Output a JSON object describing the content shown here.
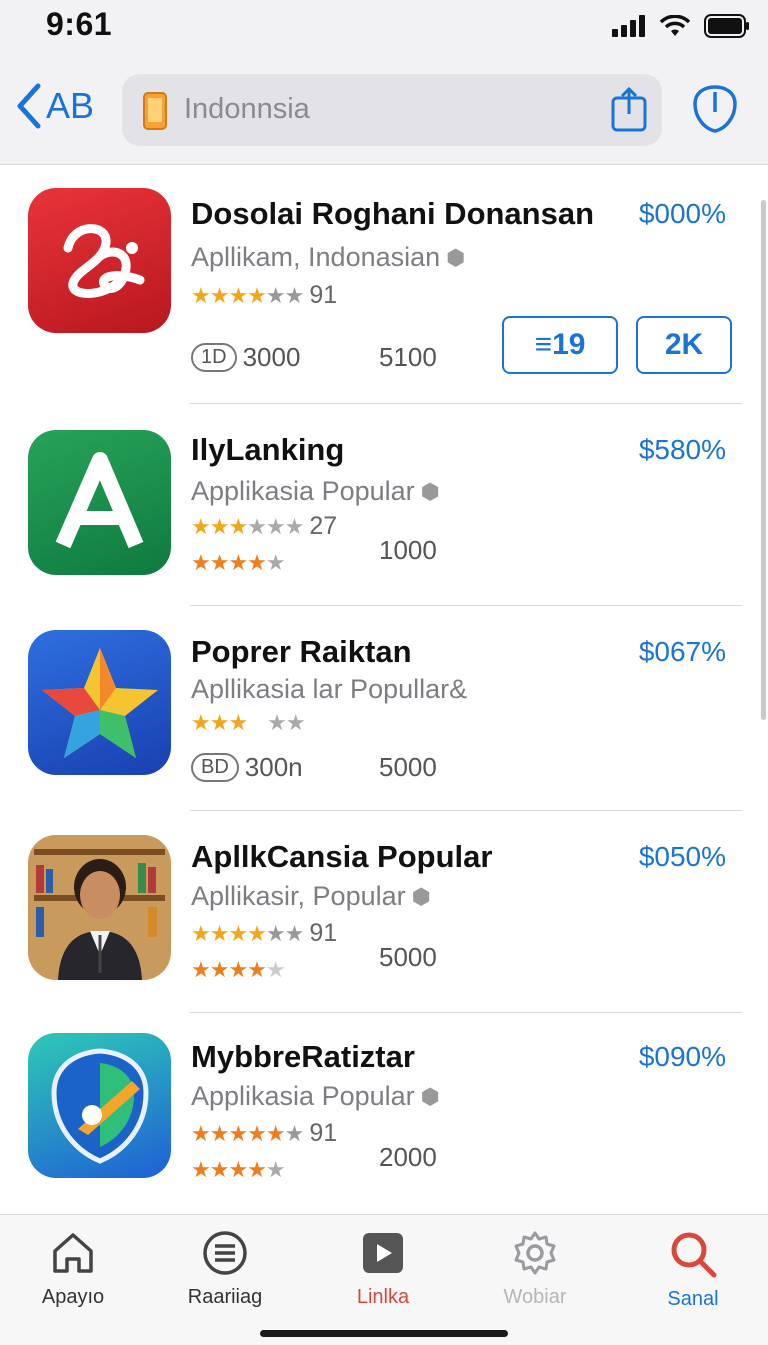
{
  "status_bar": {
    "time": "9:61"
  },
  "nav": {
    "back_label": "AB",
    "search_value": "Indonnsia"
  },
  "apps": [
    {
      "name": "Dosolai Roghani Donansan",
      "subtitle": "Apllikam, Indonasian",
      "price": "$000%",
      "rating_stars": 4,
      "rating_count": "91",
      "badge": "1D",
      "meta_1": "3000",
      "meta_2": "5100",
      "buttons": [
        "≡19",
        "2K"
      ],
      "icon": "script-logo-icon"
    },
    {
      "name": "IlyLanking",
      "subtitle": "Applikasia Popular",
      "price": "$580%",
      "rating_stars": 3,
      "rating_count": "27",
      "rating2_stars": 4,
      "meta_2": "1000",
      "icon": "letter-a-icon"
    },
    {
      "name": "Poprer Raiktan",
      "subtitle": "Apllikasia lar Popullar&",
      "price": "$067%",
      "rating_stars": 3,
      "badge": "BD",
      "meta_1": "300n",
      "meta_2": "5000",
      "icon": "star-icon"
    },
    {
      "name": "ApllkCansia Popular",
      "subtitle": "Apllikasir, Popular",
      "price": "$050%",
      "rating_stars": 4,
      "rating_count": "91",
      "rating2_stars": 4,
      "meta_2": "5000",
      "icon": "person-portrait-icon"
    },
    {
      "name": "MybbreRatiztar",
      "subtitle": "Applikasia Popular",
      "price": "$090%",
      "rating_stars": 5,
      "rating_count": "91",
      "rating2_stars": 4,
      "meta_2": "2000",
      "icon": "shield-pen-icon"
    }
  ],
  "tabs": [
    {
      "label": "Apayıo",
      "icon": "home-icon",
      "color": "#333333"
    },
    {
      "label": "Raariiag",
      "icon": "list-icon",
      "color": "#333333"
    },
    {
      "label": "Linlka",
      "icon": "play-icon",
      "color": "#d9483b"
    },
    {
      "label": "Wobiar",
      "icon": "gear-icon",
      "color": "#b5b5ba"
    },
    {
      "label": "Sanal",
      "icon": "search-icon",
      "color": "#1a73d9"
    }
  ],
  "colors": {
    "accent": "#1a73d9",
    "star": "#f2a61c"
  }
}
